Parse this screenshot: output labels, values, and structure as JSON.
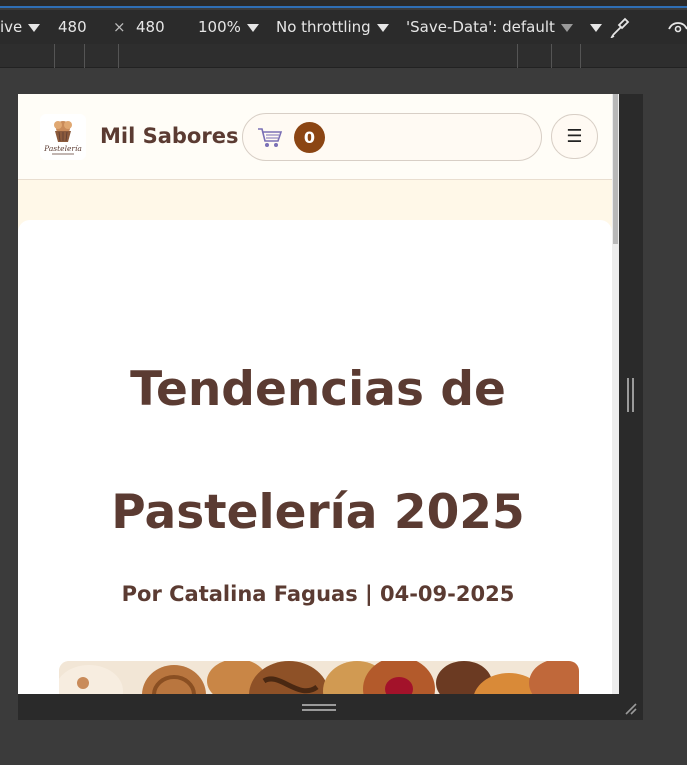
{
  "devtools": {
    "device": "ive",
    "width": "480",
    "times": "×",
    "height": "480",
    "zoom": "100%",
    "throttling": "No throttling",
    "save_data": "'Save-Data': default"
  },
  "header": {
    "brand": "Mil Sabores",
    "cart_count": "0",
    "menu_glyph": "☰",
    "logo_text": "Pastelería"
  },
  "article": {
    "title_line1": "Tendencias de",
    "title_line2": "Pastelería 2025",
    "byline": "Por Catalina Faguas | 04-09-2025"
  },
  "colors": {
    "brand_brown": "#5b3b32",
    "badge_brown": "#8b4513",
    "page_cream": "#fff8e8"
  },
  "icons": [
    "dropdown-arrow-icon",
    "eyedropper-icon",
    "cart-icon",
    "menu-icon",
    "logo-cupcake-icon"
  ]
}
